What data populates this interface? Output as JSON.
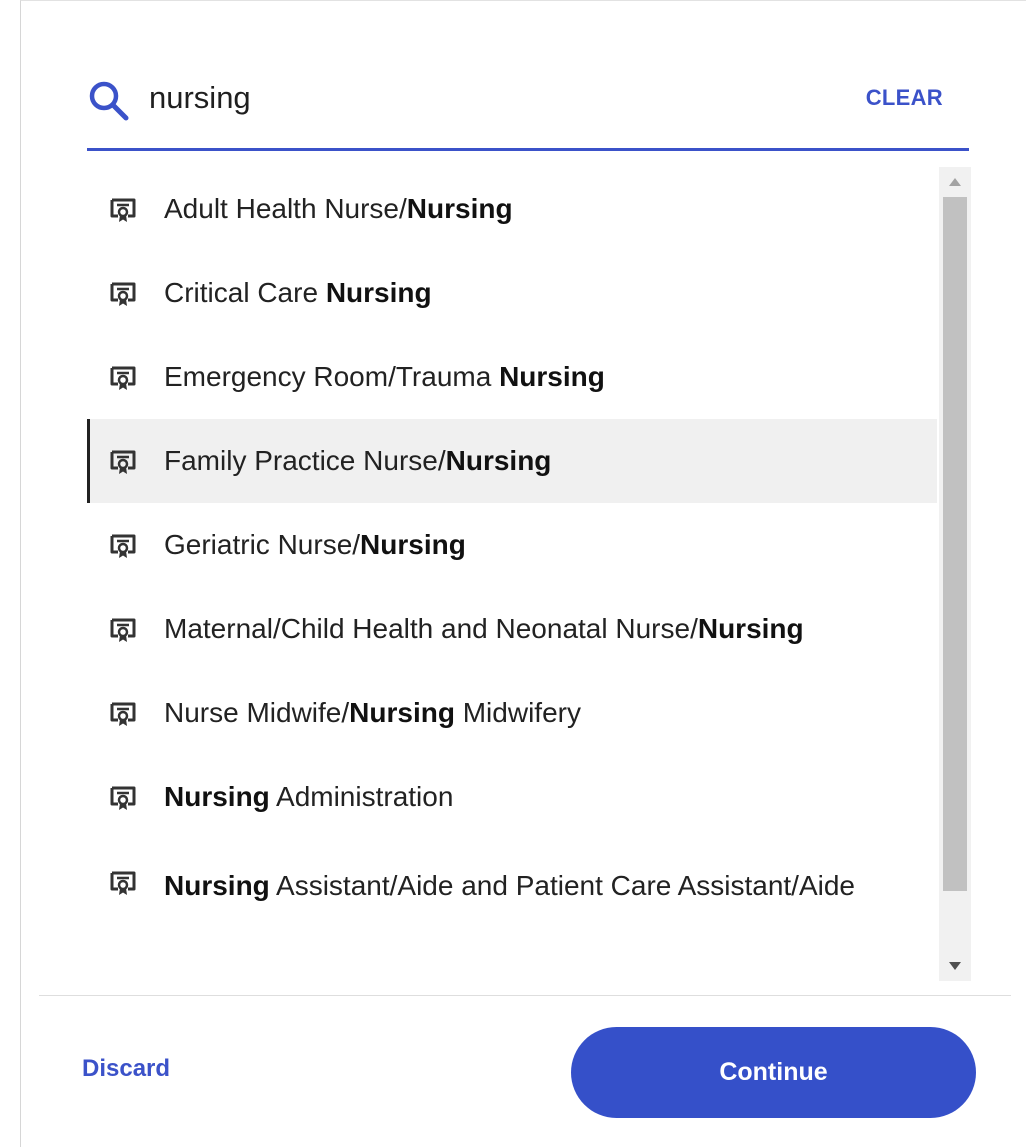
{
  "search": {
    "value": "nursing",
    "clear_label": "CLEAR"
  },
  "results": [
    {
      "pre": "Adult Health Nurse/",
      "match": "Nursing",
      "post": "",
      "icon": "certificate-icon"
    },
    {
      "pre": "Critical Care ",
      "match": "Nursing",
      "post": "",
      "icon": "certificate-icon"
    },
    {
      "pre": "Emergency Room/Trauma ",
      "match": "Nursing",
      "post": "",
      "icon": "certificate-icon"
    },
    {
      "pre": "Family Practice Nurse/",
      "match": "Nursing",
      "post": "",
      "icon": "certificate-icon",
      "selected": true
    },
    {
      "pre": "Geriatric Nurse/",
      "match": "Nursing",
      "post": "",
      "icon": "certificate-icon"
    },
    {
      "pre": "Maternal/Child Health and Neonatal Nurse/",
      "match": "Nursing",
      "post": "",
      "icon": "certificate-icon"
    },
    {
      "pre": "Nurse Midwife/",
      "match": "Nursing",
      "post": " Midwifery",
      "icon": "certificate-icon"
    },
    {
      "pre": "",
      "match": "Nursing",
      "post": " Administration",
      "icon": "certificate-icon"
    },
    {
      "pre": "",
      "match": "Nursing",
      "post": " Assistant/Aide and Patient Care Assistant/Aide",
      "icon": "certificate-icon"
    }
  ],
  "footer": {
    "discard_label": "Discard",
    "continue_label": "Continue"
  },
  "colors": {
    "accent": "#3b52c9",
    "button": "#3550c9",
    "selected_row": "#f0f0f0"
  }
}
